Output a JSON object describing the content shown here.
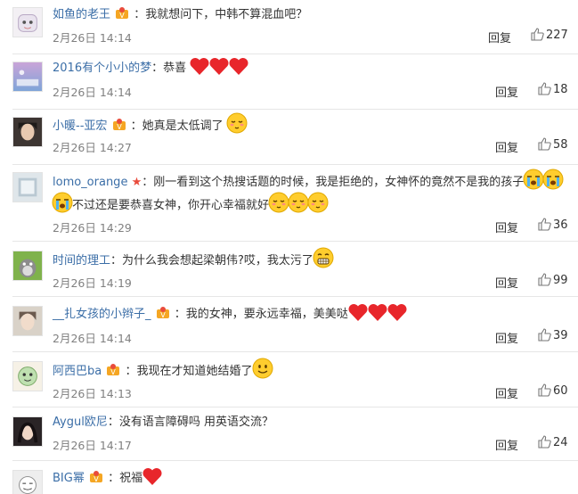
{
  "comments": [
    {
      "name": "如鱼的老王",
      "badge": true,
      "text": "：我就想问下，中韩不算混血吧？",
      "date": "2月26日",
      "time": "14:14",
      "reply": "回复",
      "likes": "227",
      "emojis": []
    },
    {
      "name": "2016有个小小的梦",
      "badge": false,
      "text": "：恭喜",
      "date": "2月26日",
      "time": "14:14",
      "reply": "回复",
      "likes": "18",
      "emojis": [
        "heart-emoji",
        "heart-emoji",
        "heart-emoji"
      ]
    },
    {
      "name": "小暖--亚宏",
      "badge": true,
      "text": "：她真是太低调了",
      "date": "2月26日",
      "time": "14:27",
      "reply": "回复",
      "likes": "58",
      "emojis": [
        "blush-emoji"
      ]
    },
    {
      "name": "lomo_orange",
      "star": true,
      "text": "：刚一看到这个热搜话题的时候，我是拒绝的，女神怀的竟然不是我的孩子",
      "text2": "不过还是要恭喜女神，你开心幸福就好",
      "date": "2月26日",
      "time": "14:29",
      "reply": "回复",
      "likes": "36",
      "emojis": [
        "crying-emoji",
        "crying-emoji"
      ]
    },
    {
      "name": "时间的理工",
      "badge": false,
      "text": "：为什么我会想起梁朝伟?哎，我太污了",
      "date": "2月26日",
      "time": "14:19",
      "reply": "回复",
      "likes": "99",
      "emojis": [
        "grin-emoji"
      ]
    },
    {
      "name": "__扎女孩的小辫子_",
      "badge": true,
      "text": "：我的女神，要永远幸福，美美哒",
      "date": "2月26日",
      "time": "14:14",
      "reply": "回复",
      "likes": "39",
      "emojis": [
        "heart-emoji",
        "heart-emoji",
        "heart-emoji"
      ]
    },
    {
      "name": "阿西巴ba",
      "badge": true,
      "text": "：我现在才知道她结婚了",
      "date": "2月26日",
      "time": "14:13",
      "reply": "回复",
      "likes": "60",
      "emojis": [
        "smile-emoji"
      ]
    },
    {
      "name": "Aygul欧尼",
      "badge": false,
      "text": "：没有语言障碍吗 用英语交流？",
      "date": "2月26日",
      "time": "14:17",
      "reply": "回复",
      "likes": "24",
      "emojis": []
    },
    {
      "name": "BIG幂",
      "badge": true,
      "text": "：祝福",
      "date": "",
      "time": "",
      "reply": "",
      "likes": "",
      "emojis": [
        "heart-emoji"
      ]
    }
  ],
  "colors": {
    "name": "#3b6ea7",
    "time": "#808080",
    "heart": "#e8262b",
    "emoji_face": "#ffcd2e",
    "border": "#e6e6e6"
  }
}
